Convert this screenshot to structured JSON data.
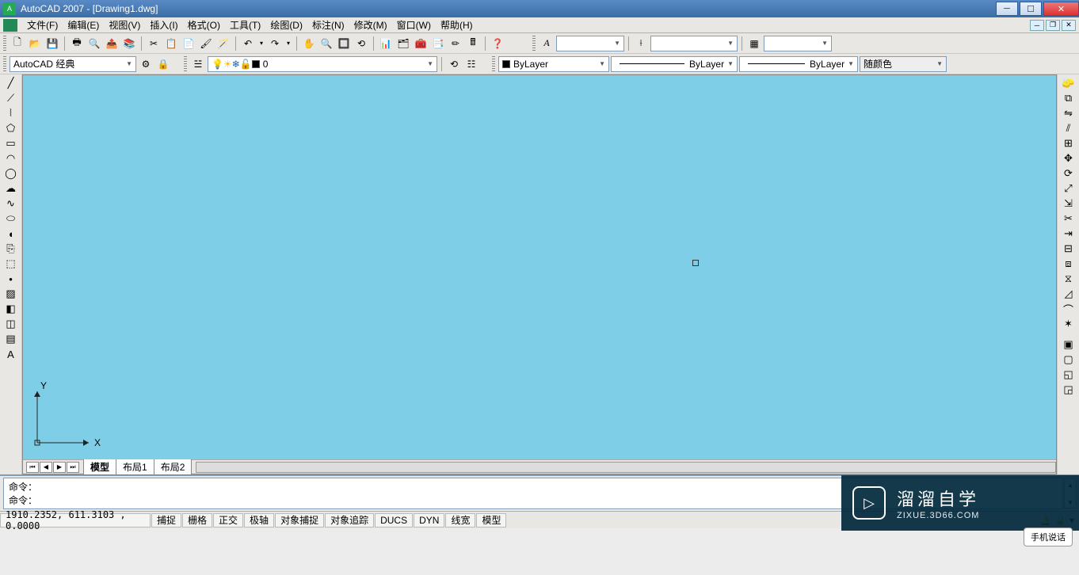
{
  "title": "AutoCAD 2007 - [Drawing1.dwg]",
  "menu": [
    "文件(F)",
    "编辑(E)",
    "视图(V)",
    "插入(I)",
    "格式(O)",
    "工具(T)",
    "绘图(D)",
    "标注(N)",
    "修改(M)",
    "窗口(W)",
    "帮助(H)"
  ],
  "workspace": "AutoCAD 经典",
  "layer_current": "0",
  "linetype_current": "ByLayer",
  "lineweight_current": "ByLayer",
  "plotstyle_current": "ByLayer",
  "color_current": "随颜色",
  "tabs": {
    "active": "模型",
    "others": [
      "布局1",
      "布局2"
    ]
  },
  "cmd1": "命令：",
  "cmd2": "命令：",
  "coords": "1910.2352, 611.3103 , 0.0000",
  "status_toggles": [
    "捕捉",
    "栅格",
    "正交",
    "极轴",
    "对象捕捉",
    "对象追踪",
    "DUCS",
    "DYN",
    "线宽",
    "模型"
  ],
  "ucs": {
    "x": "X",
    "y": "Y"
  },
  "watermark": {
    "title": "溜溜自学",
    "url": "ZIXUE.3D66.COM"
  },
  "speech": "手机说话",
  "icons": {
    "std": [
      "🗋",
      "📂",
      "💾",
      "🖶",
      "🔍",
      "✂",
      "📋",
      "📄",
      "↩",
      "↪",
      "🔙",
      "🔜",
      "🔍-",
      "🔍+",
      "🔲",
      "🖐",
      "📐",
      "📊",
      "📑",
      "📎",
      "🧮",
      "🖩",
      "❓"
    ],
    "style": [
      "A"
    ],
    "layerbar": [
      "💡",
      "❄",
      "🔒",
      "🎨",
      "▢"
    ]
  }
}
